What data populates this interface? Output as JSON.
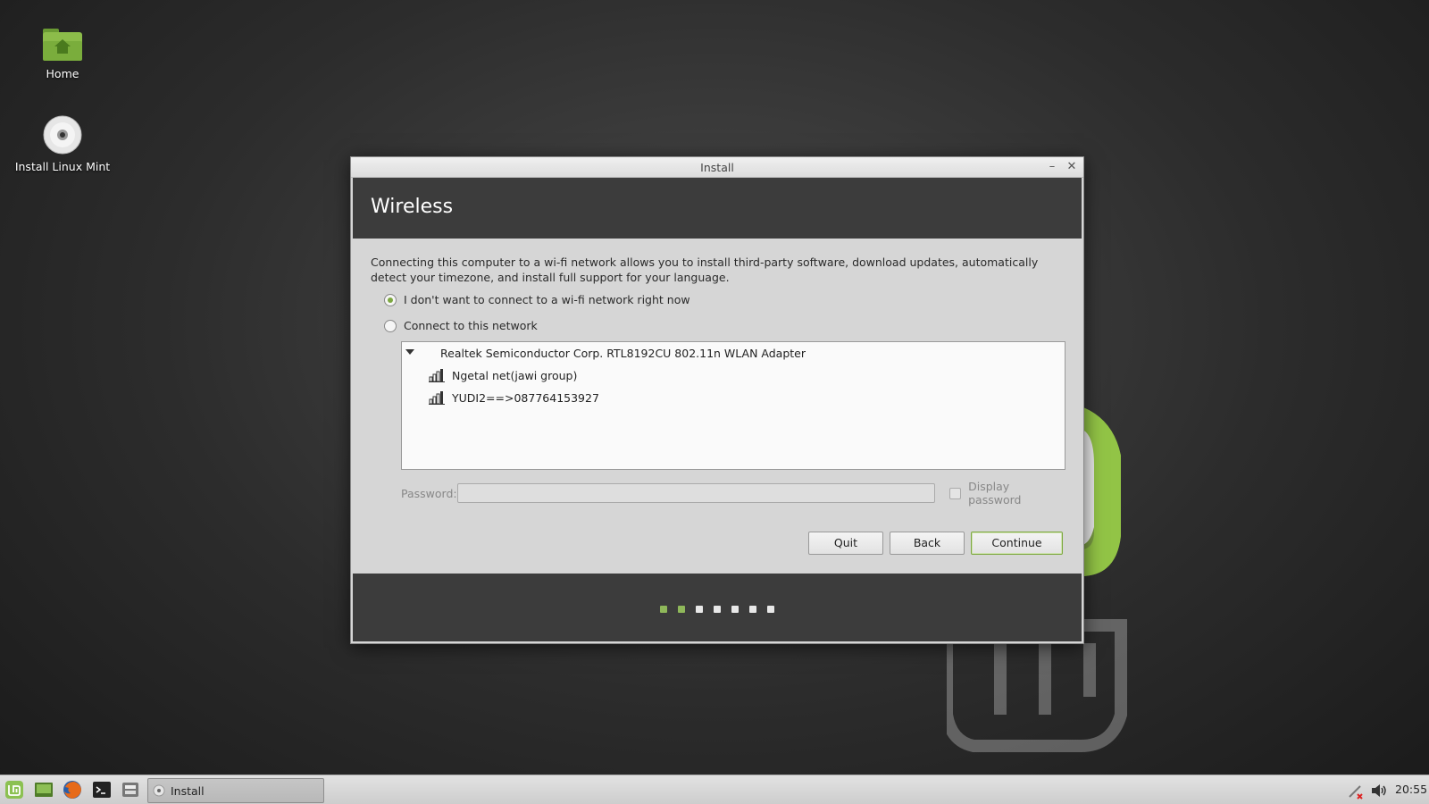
{
  "desktop": {
    "icons": [
      {
        "label": "Home"
      },
      {
        "label": "Install Linux Mint"
      }
    ]
  },
  "window": {
    "title": "Install",
    "header_title": "Wireless",
    "description": "Connecting this computer to a wi-fi network allows you to install third-party software, download updates, automatically detect your timezone, and install full support for your language.",
    "options": [
      {
        "label": "I don't want to connect to a wi-fi network right now",
        "checked": true
      },
      {
        "label": "Connect to this network",
        "checked": false
      }
    ],
    "adapter": "Realtek Semiconductor Corp. RTL8192CU 802.11n WLAN Adapter",
    "networks": [
      {
        "ssid": "Ngetal net(jawi group)"
      },
      {
        "ssid": "YUDI2==>087764153927"
      }
    ],
    "password_label": "Password:",
    "password_value": "",
    "display_password_label": "Display password",
    "buttons": {
      "quit": "Quit",
      "back": "Back",
      "continue": "Continue"
    },
    "progress": {
      "total_steps": 7,
      "completed_steps": 2
    }
  },
  "taskbar": {
    "task_label": "Install",
    "clock": "20:55"
  },
  "colors": {
    "accent": "#7da841",
    "header_bg": "#3c3c3c"
  }
}
